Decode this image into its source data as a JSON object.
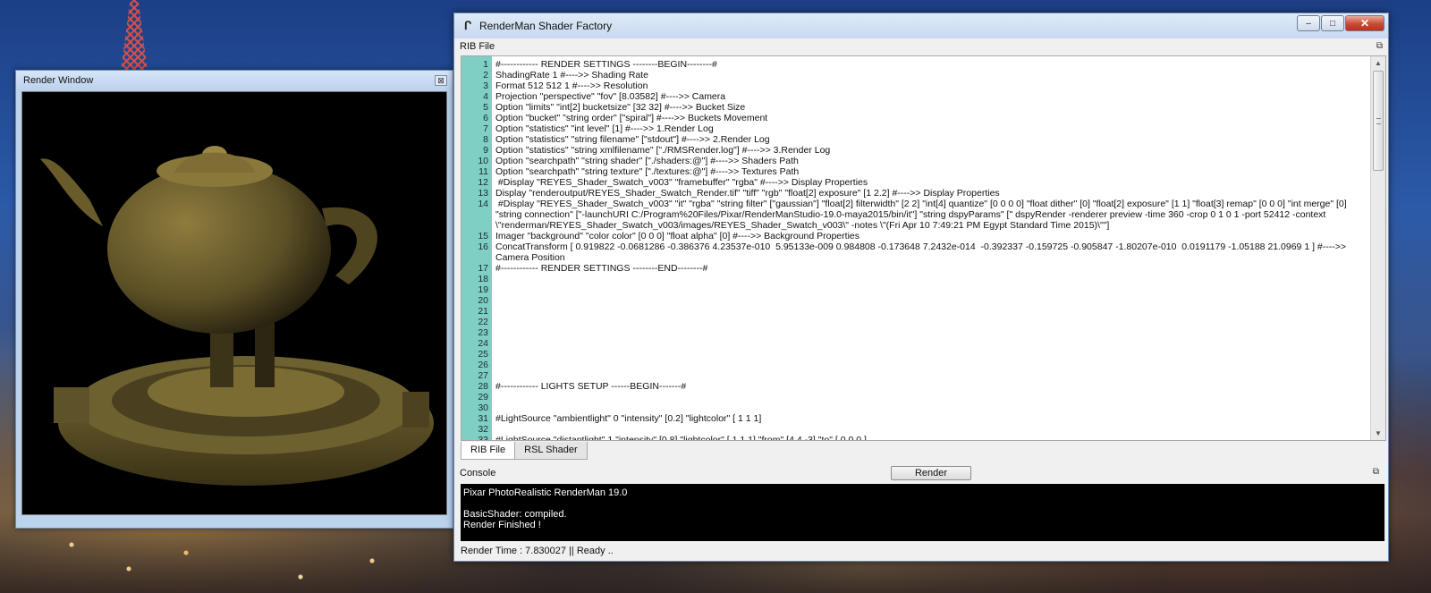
{
  "render_window": {
    "title": "Render Window",
    "close_glyph": "⊠"
  },
  "shader_factory": {
    "title": "RenderMan Shader Factory",
    "app_icon_glyph": "ᒋ",
    "buttons": {
      "minimize": "–",
      "maximize": "□",
      "close": "✕"
    },
    "rib_panel_title": "RIB File",
    "dock_float_glyph": "⧉",
    "code_lines": [
      {
        "n": "1",
        "text": "#------------ RENDER SETTINGS --------BEGIN--------#"
      },
      {
        "n": "2",
        "text": "ShadingRate 1 #---->> Shading Rate"
      },
      {
        "n": "3",
        "text": "Format 512 512 1 #---->> Resolution"
      },
      {
        "n": "4",
        "text": "Projection \"perspective\" \"fov\" [8.03582] #---->> Camera"
      },
      {
        "n": "5",
        "text": "Option \"limits\" \"int[2] bucketsize\" [32 32] #---->> Bucket Size"
      },
      {
        "n": "6",
        "text": "Option \"bucket\" \"string order\" [\"spiral\"] #---->> Buckets Movement"
      },
      {
        "n": "7",
        "text": "Option \"statistics\" \"int level\" [1] #---->> 1.Render Log"
      },
      {
        "n": "8",
        "text": "Option \"statistics\" \"string filename\" [\"stdout\"] #---->> 2.Render Log"
      },
      {
        "n": "9",
        "text": "Option \"statistics\" \"string xmlfilename\" [\"./RMSRender.log\"] #---->> 3.Render Log"
      },
      {
        "n": "10",
        "text": "Option \"searchpath\" \"string shader\" [\"./shaders:@\"] #---->> Shaders Path"
      },
      {
        "n": "11",
        "text": "Option \"searchpath\" \"string texture\" [\"./textures:@\"] #---->> Textures Path"
      },
      {
        "n": "12",
        "text": " #Display \"REYES_Shader_Swatch_v003\" \"framebuffer\" \"rgba\" #---->> Display Properties"
      },
      {
        "n": "13",
        "text": "Display \"renderoutput/REYES_Shader_Swatch_Render.tif\" \"tiff\" \"rgb\" \"float[2] exposure\" [1 2.2] #---->> Display Properties"
      },
      {
        "n": "14",
        "text": " #Display \"REYES_Shader_Swatch_v003\" \"it\" \"rgba\" \"string filter\" [\"gaussian\"] \"float[2] filterwidth\" [2 2] \"int[4] quantize\" [0 0 0 0] \"float dither\" [0] \"float[2] exposure\" [1 1] \"float[3] remap\" [0 0 0] \"int merge\" [0] \"string connection\" [\"-launchURI C:/Program%20Files/Pixar/RenderManStudio-19.0-maya2015/bin/it\"] \"string dspyParams\" [\" dspyRender -renderer preview -time 360 -crop 0 1 0 1 -port 52412 -context \\\"renderman/REYES_Shader_Swatch_v003/images/REYES_Shader_Swatch_v003\\\" -notes \\\"(Fri Apr 10 7:49:21 PM Egypt Standard Time 2015)\\\"\"]"
      },
      {
        "n": "15",
        "text": "Imager \"background\" \"color color\" [0 0 0] \"float alpha\" [0] #---->> Background Properties"
      },
      {
        "n": "16",
        "text": "ConcatTransform [ 0.919822 -0.0681286 -0.386376 4.23537e-010  5.95133e-009 0.984808 -0.173648 7.2432e-014  -0.392337 -0.159725 -0.905847 -1.80207e-010  0.0191179 -1.05188 21.0969 1 ] #---->> Camera Position"
      },
      {
        "n": "17",
        "text": "#------------ RENDER SETTINGS --------END--------#"
      },
      {
        "n": "18",
        "text": ""
      },
      {
        "n": "19",
        "text": ""
      },
      {
        "n": "20",
        "text": ""
      },
      {
        "n": "21",
        "text": ""
      },
      {
        "n": "22",
        "text": ""
      },
      {
        "n": "23",
        "text": ""
      },
      {
        "n": "24",
        "text": ""
      },
      {
        "n": "25",
        "text": ""
      },
      {
        "n": "26",
        "text": ""
      },
      {
        "n": "27",
        "text": ""
      },
      {
        "n": "28",
        "text": "#------------ LIGHTS SETUP ------BEGIN-------#"
      },
      {
        "n": "29",
        "text": ""
      },
      {
        "n": "30",
        "text": ""
      },
      {
        "n": "31",
        "text": "#LightSource \"ambientlight\" 0 \"intensity\" [0.2] \"lightcolor\" [ 1 1 1]"
      },
      {
        "n": "32",
        "text": ""
      },
      {
        "n": "33",
        "text": "#LightSource \"distantlight\" 1 \"intensity\" [0.8] \"lightcolor\" [ 1 1 1] \"from\" [4 4 -3] \"to\" [ 0 0 0 ]"
      }
    ],
    "tabs": [
      {
        "label": "RIB File",
        "active": true
      },
      {
        "label": "RSL Shader",
        "active": false
      }
    ],
    "console_title": "Console",
    "render_button": "Render",
    "console_lines": [
      "Pixar PhotoRealistic RenderMan 19.0",
      "",
      "BasicShader: compiled.",
      "Render Finished !"
    ],
    "status": "Render Time : 7.830027 || Ready .."
  },
  "colors": {
    "gutter": "#7fcfc4",
    "teapot": "#8c7a3a",
    "console_bg": "#000000"
  }
}
